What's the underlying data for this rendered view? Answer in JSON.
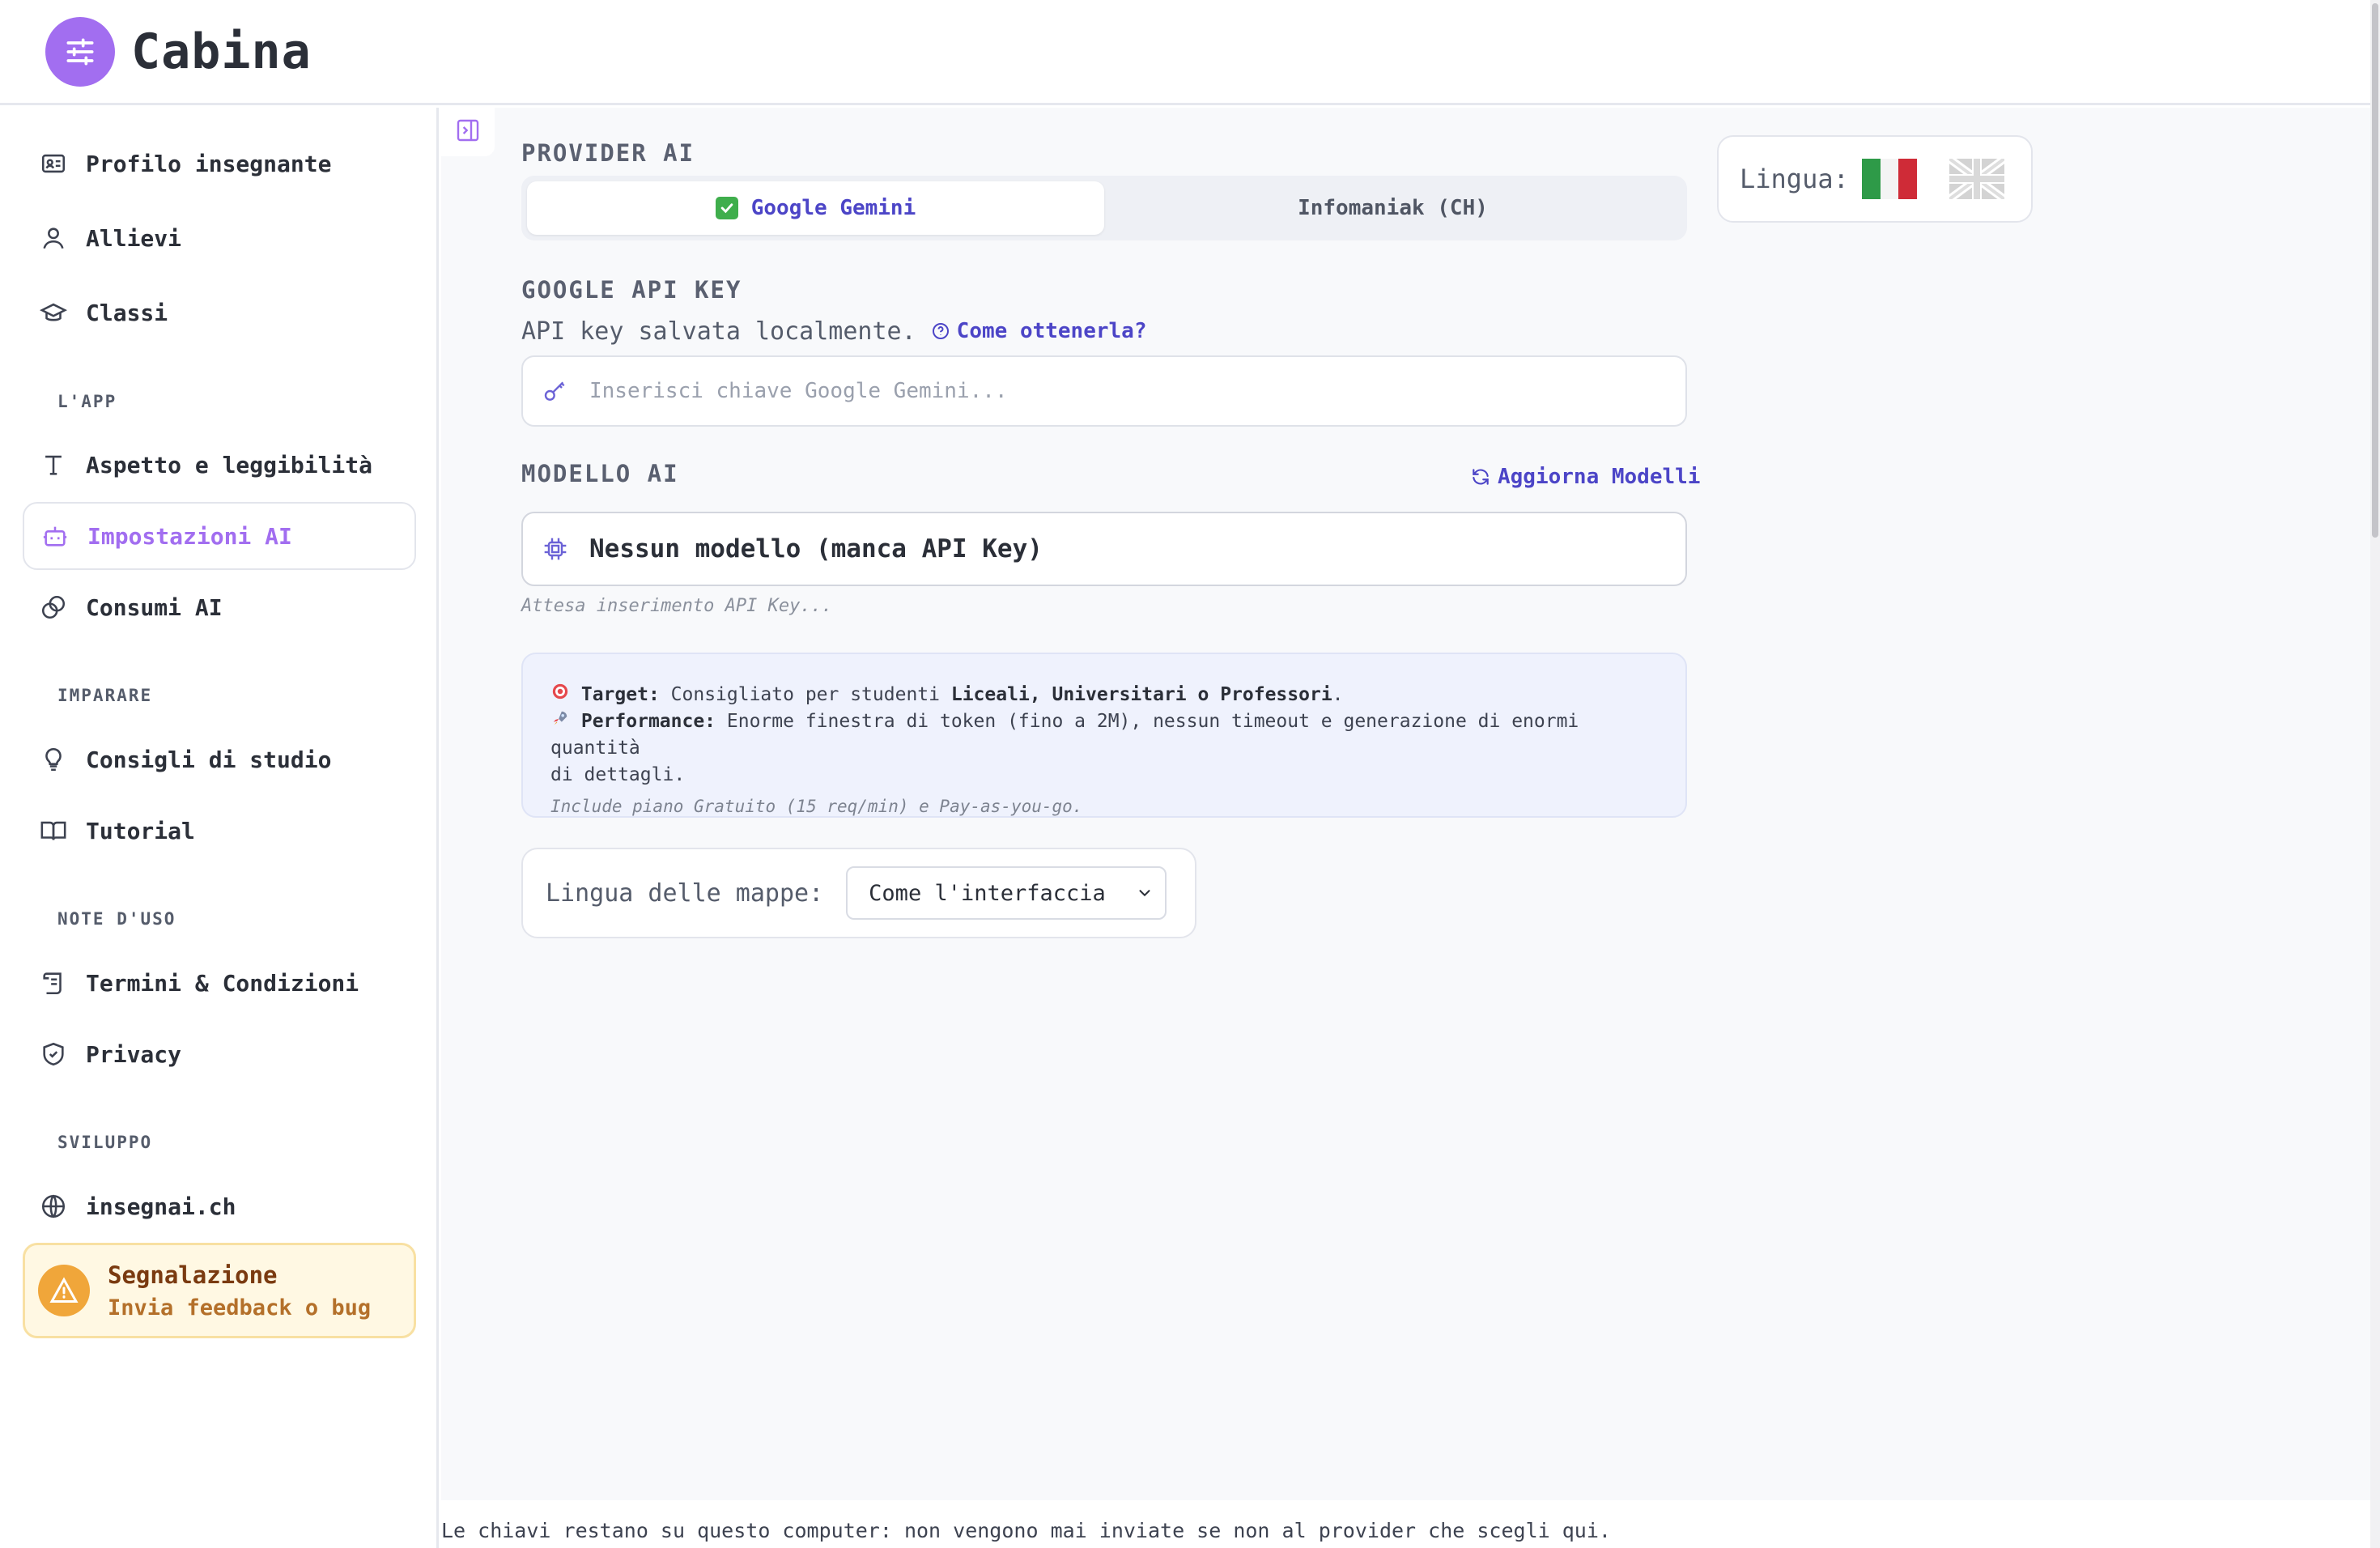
{
  "header": {
    "app_title": "Cabina"
  },
  "sidebar": {
    "items": [
      {
        "label": "Profilo insegnante"
      },
      {
        "label": "Allievi"
      },
      {
        "label": "Classi"
      },
      {
        "label": "Aspetto e leggibilità"
      },
      {
        "label": "Impostazioni AI"
      },
      {
        "label": "Consumi AI"
      },
      {
        "label": "Consigli di studio"
      },
      {
        "label": "Tutorial"
      },
      {
        "label": "Termini & Condizioni"
      },
      {
        "label": "Privacy"
      },
      {
        "label": "insegnai.ch"
      }
    ],
    "sections": [
      "L'APP",
      "IMPARARE",
      "NOTE D'USO",
      "SVILUPPO"
    ],
    "active_item": "Impostazioni AI",
    "feedback": {
      "title": "Segnalazione",
      "subtitle": "Invia feedback o bug"
    }
  },
  "main": {
    "provider_label": "PROVIDER AI",
    "tabs": [
      {
        "label": "Google Gemini"
      },
      {
        "label": "Infomaniak (CH)"
      }
    ],
    "api_key_label": "GOOGLE API KEY",
    "api_key_hint": "API key salvata localmente.",
    "api_key_link": "Come ottenerla?",
    "api_key_placeholder": "Inserisci chiave Google Gemini...",
    "api_key_value": "",
    "model_label": "MODELLO AI",
    "refresh_label": "Aggiorna Modelli",
    "model_value": "Nessun modello (manca API Key)",
    "model_note": "Attesa inserimento API Key...",
    "info": {
      "target_label": "Target:",
      "target_text": "Consigliato per studenti",
      "target_bold": "Liceali, Universitari o Professori",
      "target_end": ".",
      "perf_label": "Performance:",
      "perf_text_1": "Enorme finestra di token (fino a 2M), nessun timeout e generazione di enormi quantità",
      "perf_text_2": "di dettagli.",
      "plan_note": "Include piano Gratuito (15 req/min) e Pay-as-you-go."
    },
    "map_lang_label": "Lingua delle mappe:",
    "map_lang_value": "Come l'interfaccia"
  },
  "lang_selector": {
    "label": "Lingua:",
    "options": [
      "it",
      "en"
    ],
    "active": "it"
  },
  "footer": {
    "text": "Le chiavi restano su questo computer: non vengono mai inviate se non al provider che scegli qui."
  },
  "colors": {
    "accent": "#a26ef0",
    "link": "#4c45c7",
    "warning": "#f0a63a"
  }
}
